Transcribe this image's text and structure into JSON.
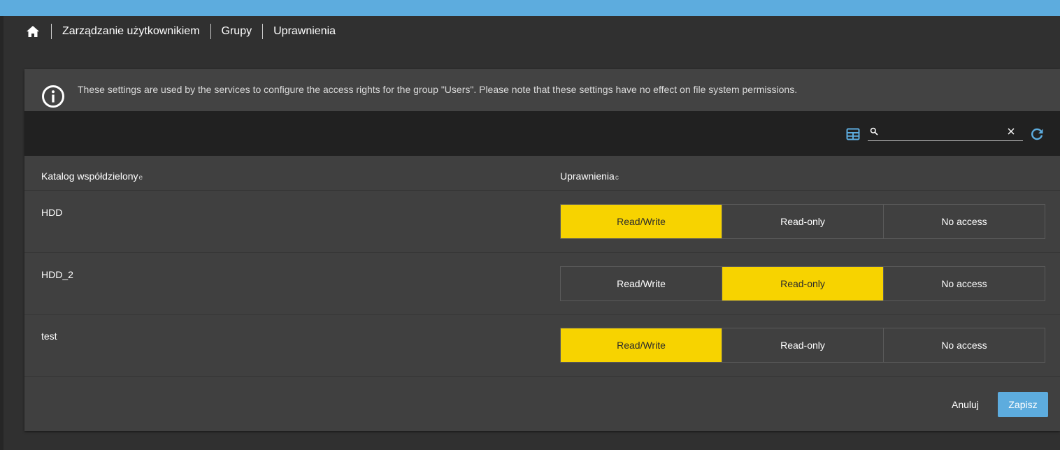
{
  "breadcrumb": {
    "items": [
      "Zarządzanie użytkownikiem",
      "Grupy",
      "Uprawnienia"
    ]
  },
  "info": {
    "text": "These settings are used by the services to configure the access rights for the group \"Users\". Please note that these settings have no effect on file system permissions."
  },
  "toolbar": {
    "search_value": "",
    "search_placeholder": ""
  },
  "table": {
    "columns": [
      {
        "label": "Katalog współdzielony",
        "sort_marker": "e"
      },
      {
        "label": "Uprawnienia",
        "sort_marker": "c"
      }
    ],
    "options": [
      "Read/Write",
      "Read-only",
      "No access"
    ],
    "rows": [
      {
        "name": "HDD",
        "selected": "Read/Write"
      },
      {
        "name": "HDD_2",
        "selected": "Read-only"
      },
      {
        "name": "test",
        "selected": "Read/Write"
      }
    ]
  },
  "footer": {
    "cancel_label": "Anuluj",
    "save_label": "Zapisz"
  },
  "colors": {
    "accent": "#5dacde",
    "selected": "#f7d300",
    "background": "#303030",
    "card": "#404040",
    "toolbar": "#212121"
  }
}
